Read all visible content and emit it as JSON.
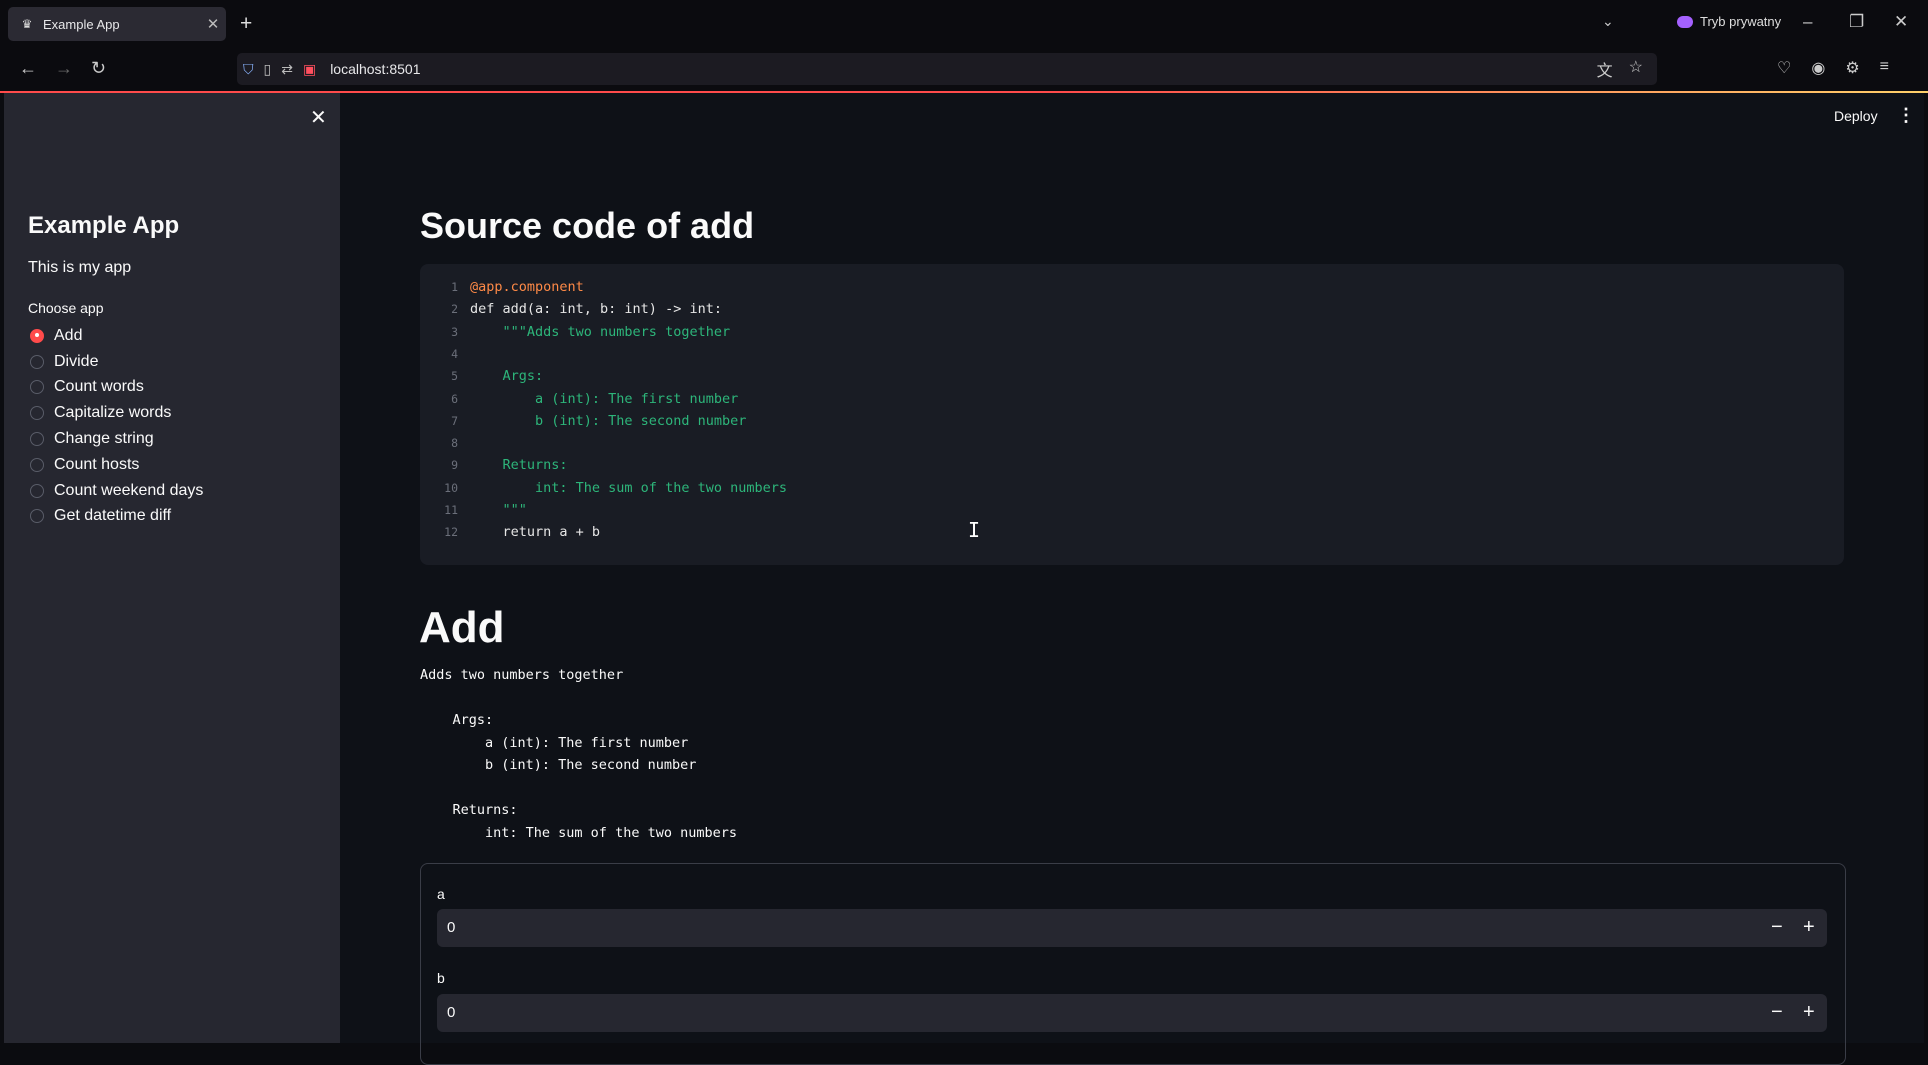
{
  "browser": {
    "tab_title": "Example App",
    "new_tab": "+",
    "url": "localhost:8501",
    "private_label": "Tryb prywatny"
  },
  "sidebar": {
    "title": "Example App",
    "caption": "This is my app",
    "radio_label": "Choose app",
    "options": [
      "Add",
      "Divide",
      "Count words",
      "Capitalize words",
      "Change string",
      "Count hosts",
      "Count weekend days",
      "Get datetime diff"
    ],
    "selected": "Add"
  },
  "header": {
    "deploy_label": "Deploy"
  },
  "main": {
    "source_heading": "Source code of add",
    "code_lines": [
      "@app.component",
      "def add(a: int, b: int) -> int:",
      "    \"\"\"Adds two numbers together",
      "",
      "    Args:",
      "        a (int): The first number",
      "        b (int): The second number",
      "",
      "    Returns:",
      "        int: The sum of the two numbers",
      "    \"\"\"",
      "    return a + b"
    ],
    "line_numbers": [
      "1",
      "2",
      "3",
      "4",
      "5",
      "6",
      "7",
      "8",
      "9",
      "10",
      "11",
      "12"
    ],
    "component_heading": "Add",
    "docstring": "Adds two numbers together\n\n    Args:\n        a (int): The first number\n        b (int): The second number\n\n    Returns:\n        int: The sum of the two numbers",
    "inputs": [
      {
        "label": "a",
        "value": "0"
      },
      {
        "label": "b",
        "value": "0"
      }
    ]
  },
  "colors": {
    "accent": "#ff4b4b",
    "sidebar_bg": "#262730",
    "main_bg": "#0e1117",
    "code_bg": "#191c24"
  }
}
